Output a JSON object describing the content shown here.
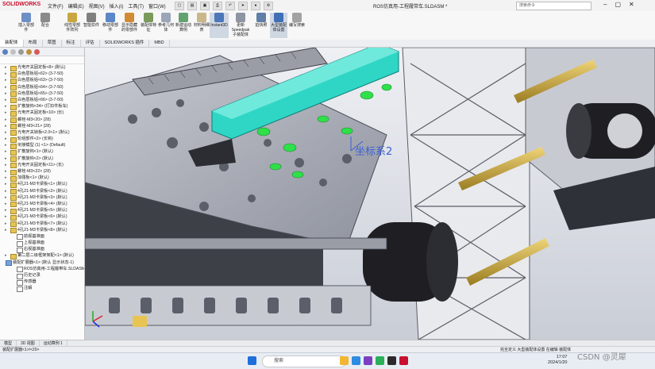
{
  "app": {
    "logo_text": "SOLIDWORKS",
    "document_title": "ROS仿真用-工程履带车.SLDASM *",
    "search_placeholder": "搜索命令",
    "menus": [
      "文件(F)",
      "编辑(E)",
      "视图(V)",
      "插入(I)",
      "工具(T)",
      "窗口(W)"
    ]
  },
  "ribbon": {
    "buttons": [
      "插入零部件",
      "配合",
      "线性零部件阵列",
      "智能扣件",
      "移动零部件",
      "显示隐藏的零部件",
      "装配体特征",
      "参考几何体",
      "新建运动算例",
      "材料明细表",
      "Instant3D",
      "更新Speedpak子装配体",
      "拍快照",
      "大型装配体设置",
      "编写搜索"
    ]
  },
  "command_tabs": [
    "装配体",
    "布局",
    "草图",
    "标注",
    "评估",
    "SOLIDWORKS 插件",
    "MBD"
  ],
  "feature_tree": {
    "filter_text": "",
    "rows": [
      {
        "label": "光电开关固定板<8> (默认)",
        "level": 1
      },
      {
        "label": "白色层板铝<62> (3-7-50)",
        "level": 1
      },
      {
        "label": "白色层板铝<63> (3-7-50)",
        "level": 1
      },
      {
        "label": "白色层板铝<64> (3-7-50)",
        "level": 1
      },
      {
        "label": "白色层板铝<65> (3-7-50)",
        "level": 1
      },
      {
        "label": "白色层板铝<66> (3-7-50)",
        "level": 1
      },
      {
        "label": "扩散旋钩<34> (打扣件板车)",
        "level": 1
      },
      {
        "label": "光电开关固定板<10> (长)",
        "level": 1
      },
      {
        "label": "螺栓-M3<20> (28)",
        "level": 1
      },
      {
        "label": "螺栓-M3<21> (28)",
        "level": 1
      },
      {
        "label": "光电开关锁板<2.0<1> (默认)",
        "level": 1
      },
      {
        "label": "轮组部件<2> (长钩)",
        "level": 1
      },
      {
        "label": "衔接模型 (1) <1> (Default)",
        "level": 1
      },
      {
        "label": "扩散旋钩<1> (默认)",
        "level": 1
      },
      {
        "label": "扩散旋钩<2> (默认)",
        "level": 1
      },
      {
        "label": "光电开关固定板<11> (长)",
        "level": 1
      },
      {
        "label": "螺栓-M3<22> (28)",
        "level": 1
      },
      {
        "label": "加强板<1> (默认)",
        "level": 1
      },
      {
        "label": "4孔21-M3卡梁板<1> (默认)",
        "level": 1
      },
      {
        "label": "4孔21-M3卡梁板<2> (默认)",
        "level": 1
      },
      {
        "label": "4孔21-M3卡梁板<3> (默认)",
        "level": 1
      },
      {
        "label": "4孔21-M3卡梁板<4> (默认)",
        "level": 1
      },
      {
        "label": "4孔21-M3卡梁板<5> (默认)",
        "level": 1
      },
      {
        "label": "4孔21-M3卡梁板<6> (默认)",
        "level": 1
      },
      {
        "label": "4孔21-M3卡梁板<7> (默认)",
        "level": 1
      },
      {
        "label": "4孔21-M3卡梁板<8> (默认)",
        "level": 1
      },
      {
        "label": "前视基准面",
        "level": 2
      },
      {
        "label": "上视基准面",
        "level": 2
      },
      {
        "label": "右视基准面",
        "level": 2
      },
      {
        "label": "第二层二级框架架配<1> (默认)",
        "level": 1
      },
      {
        "label": "装配扩展器<1> (默认 显示状态-1)",
        "level": 0
      },
      {
        "label": "ROS仿真用-工程履带车.SLDASM",
        "level": 2
      },
      {
        "label": "历史记录",
        "level": 2
      },
      {
        "label": "传感器",
        "level": 2
      },
      {
        "label": "注解",
        "level": 2
      }
    ]
  },
  "viewport": {
    "coord_label": "坐标系2"
  },
  "bottom_tabs": [
    "模型",
    "3D 视图",
    "运动算例 1"
  ],
  "status": {
    "left": "装配扩展器<1>/<20>",
    "right": "完全定义  大型装配体设置  在编辑 装配体"
  },
  "taskbar": {
    "search_placeholder": "搜索",
    "time": "17:07",
    "date": "2024/1/20"
  },
  "colors": {
    "accent_cyan": "#2fd6c5",
    "brand_red": "#c8102e",
    "plate_gray": "#b8bac4",
    "green_holes": "#2fe04a",
    "brass_rods": "#c8a83a"
  },
  "watermark": "CSDN @灵犀"
}
